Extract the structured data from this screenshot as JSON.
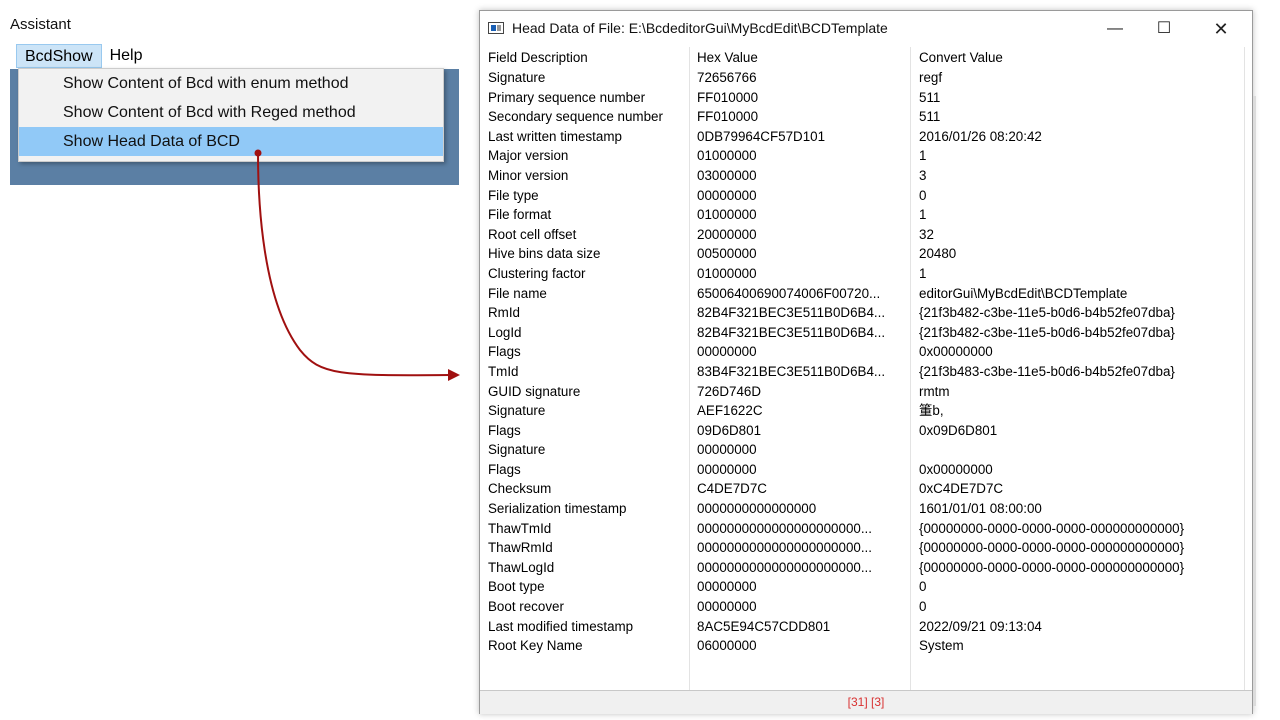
{
  "app": {
    "title": "Assistant",
    "menu": [
      {
        "label": "BcdShow"
      },
      {
        "label": "Help"
      }
    ],
    "dropdown": [
      {
        "label": "Show Content of Bcd with enum method"
      },
      {
        "label": "Show Content of Bcd with Reged method"
      },
      {
        "label": "Show Head Data of BCD"
      }
    ],
    "canvas_color": "#5b7fa4",
    "highlight_color": "#91c9f7"
  },
  "arrow": {
    "color": "#a01010"
  },
  "dialog": {
    "title": "Head Data of File: E:\\BcdeditorGui\\MyBcdEdit\\BCDTemplate",
    "controls": {
      "minimize": "—",
      "maximize": "☐",
      "close": "✕"
    },
    "columns": [
      "Field Description",
      "Hex Value",
      "Convert Value"
    ],
    "rows": [
      [
        "Signature",
        "72656766",
        "regf"
      ],
      [
        "Primary sequence number",
        "FF010000",
        "511"
      ],
      [
        "Secondary sequence number",
        "FF010000",
        "511"
      ],
      [
        "Last written timestamp",
        "0DB79964CF57D101",
        "2016/01/26 08:20:42"
      ],
      [
        "Major version",
        "01000000",
        "1"
      ],
      [
        "Minor version",
        "03000000",
        "3"
      ],
      [
        "File type",
        "00000000",
        "0"
      ],
      [
        "File format",
        "01000000",
        "1"
      ],
      [
        "Root cell offset",
        "20000000",
        "32"
      ],
      [
        "Hive bins data size",
        "00500000",
        "20480"
      ],
      [
        "Clustering factor",
        "01000000",
        "1"
      ],
      [
        "File name",
        "65006400690074006F00720...",
        "editorGui\\MyBcdEdit\\BCDTemplate"
      ],
      [
        "RmId",
        "82B4F321BEC3E511B0D6B4...",
        "{21f3b482-c3be-11e5-b0d6-b4b52fe07dba}"
      ],
      [
        "LogId",
        "82B4F321BEC3E511B0D6B4...",
        "{21f3b482-c3be-11e5-b0d6-b4b52fe07dba}"
      ],
      [
        "Flags",
        "00000000",
        "0x00000000"
      ],
      [
        "TmId",
        "83B4F321BEC3E511B0D6B4...",
        "{21f3b483-c3be-11e5-b0d6-b4b52fe07dba}"
      ],
      [
        "GUID signature",
        "726D746D",
        "rmtm"
      ],
      [
        "Signature",
        "AEF1622C",
        "箽b,"
      ],
      [
        "Flags",
        "09D6D801",
        "0x09D6D801"
      ],
      [
        "Signature",
        "00000000",
        ""
      ],
      [
        "Flags",
        "00000000",
        "0x00000000"
      ],
      [
        "Checksum",
        "C4DE7D7C",
        "0xC4DE7D7C"
      ],
      [
        "Serialization timestamp",
        "0000000000000000",
        "1601/01/01 08:00:00"
      ],
      [
        "ThawTmId",
        "0000000000000000000000...",
        "{00000000-0000-0000-0000-000000000000}"
      ],
      [
        "ThawRmId",
        "0000000000000000000000...",
        "{00000000-0000-0000-0000-000000000000}"
      ],
      [
        "ThawLogId",
        "0000000000000000000000...",
        "{00000000-0000-0000-0000-000000000000}"
      ],
      [
        "Boot type",
        "00000000",
        "0"
      ],
      [
        "Boot recover",
        "00000000",
        "0"
      ],
      [
        "Last modified timestamp",
        "8AC5E94C57CDD801",
        "2022/09/21 09:13:04"
      ],
      [
        "Root Key Name",
        "06000000",
        "System"
      ]
    ],
    "status": "[31] [3]",
    "status_color": "#d83030"
  }
}
